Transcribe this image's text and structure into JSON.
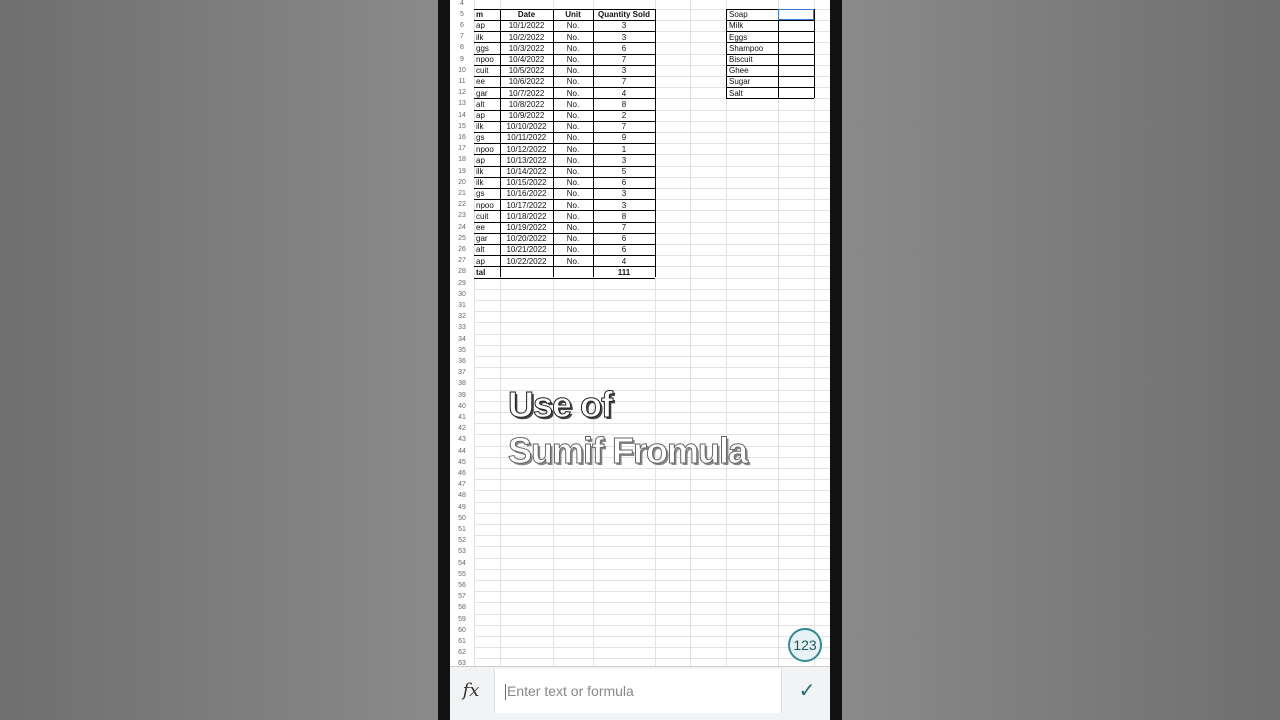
{
  "sheet": {
    "row_numbers": [
      "4",
      "5",
      "6",
      "7",
      "8",
      "9",
      "10",
      "11",
      "12",
      "13",
      "14",
      "15",
      "16",
      "17",
      "18",
      "19",
      "20",
      "21",
      "22",
      "23",
      "24",
      "25",
      "26",
      "27",
      "28",
      "29",
      "30",
      "31",
      "32",
      "33",
      "34",
      "35",
      "36",
      "37",
      "38",
      "39",
      "40",
      "41",
      "42",
      "43",
      "44",
      "45",
      "46",
      "47",
      "48",
      "49",
      "50",
      "51",
      "52",
      "53",
      "54",
      "55",
      "56",
      "57",
      "58",
      "59",
      "60",
      "61",
      "62",
      "63"
    ],
    "table": {
      "headers": [
        "m",
        "Date",
        "Unit",
        "Quantity Sold"
      ],
      "rows": [
        [
          "ap",
          "10/1/2022",
          "No.",
          "3"
        ],
        [
          "ilk",
          "10/2/2022",
          "No.",
          "3"
        ],
        [
          "ggs",
          "10/3/2022",
          "No.",
          "6"
        ],
        [
          "npoo",
          "10/4/2022",
          "No.",
          "7"
        ],
        [
          "cuit",
          "10/5/2022",
          "No.",
          "3"
        ],
        [
          "ee",
          "10/6/2022",
          "No.",
          "7"
        ],
        [
          "gar",
          "10/7/2022",
          "No.",
          "4"
        ],
        [
          "alt",
          "10/8/2022",
          "No.",
          "8"
        ],
        [
          "ap",
          "10/9/2022",
          "No.",
          "2"
        ],
        [
          "ilk",
          "10/10/2022",
          "No.",
          "7"
        ],
        [
          "gs",
          "10/11/2022",
          "No.",
          "9"
        ],
        [
          "npoo",
          "10/12/2022",
          "No.",
          "1"
        ],
        [
          "ap",
          "10/13/2022",
          "No.",
          "3"
        ],
        [
          "ilk",
          "10/14/2022",
          "No.",
          "5"
        ],
        [
          "ilk",
          "10/15/2022",
          "No.",
          "6"
        ],
        [
          "gs",
          "10/16/2022",
          "No.",
          "3"
        ],
        [
          "npoo",
          "10/17/2022",
          "No.",
          "3"
        ],
        [
          "cuit",
          "10/18/2022",
          "No.",
          "8"
        ],
        [
          "ee",
          "10/19/2022",
          "No.",
          "7"
        ],
        [
          "gar",
          "10/20/2022",
          "No.",
          "6"
        ],
        [
          "alt",
          "10/21/2022",
          "No.",
          "6"
        ],
        [
          "ap",
          "10/22/2022",
          "No.",
          "4"
        ]
      ],
      "total_label": "tal",
      "total_value": "111"
    },
    "summary_items": [
      "Soap",
      "Milk",
      "Eggs",
      "Shampoo",
      "Biscuit",
      "Ghee",
      "Sugar",
      "Salt"
    ]
  },
  "overlay": {
    "line1": "Use of",
    "line2": "Sumif Fromula"
  },
  "keyboard_toggle": "123",
  "formula_bar": {
    "fx_label": "fx",
    "placeholder": "Enter text or formula",
    "confirm_icon": "check-icon"
  }
}
